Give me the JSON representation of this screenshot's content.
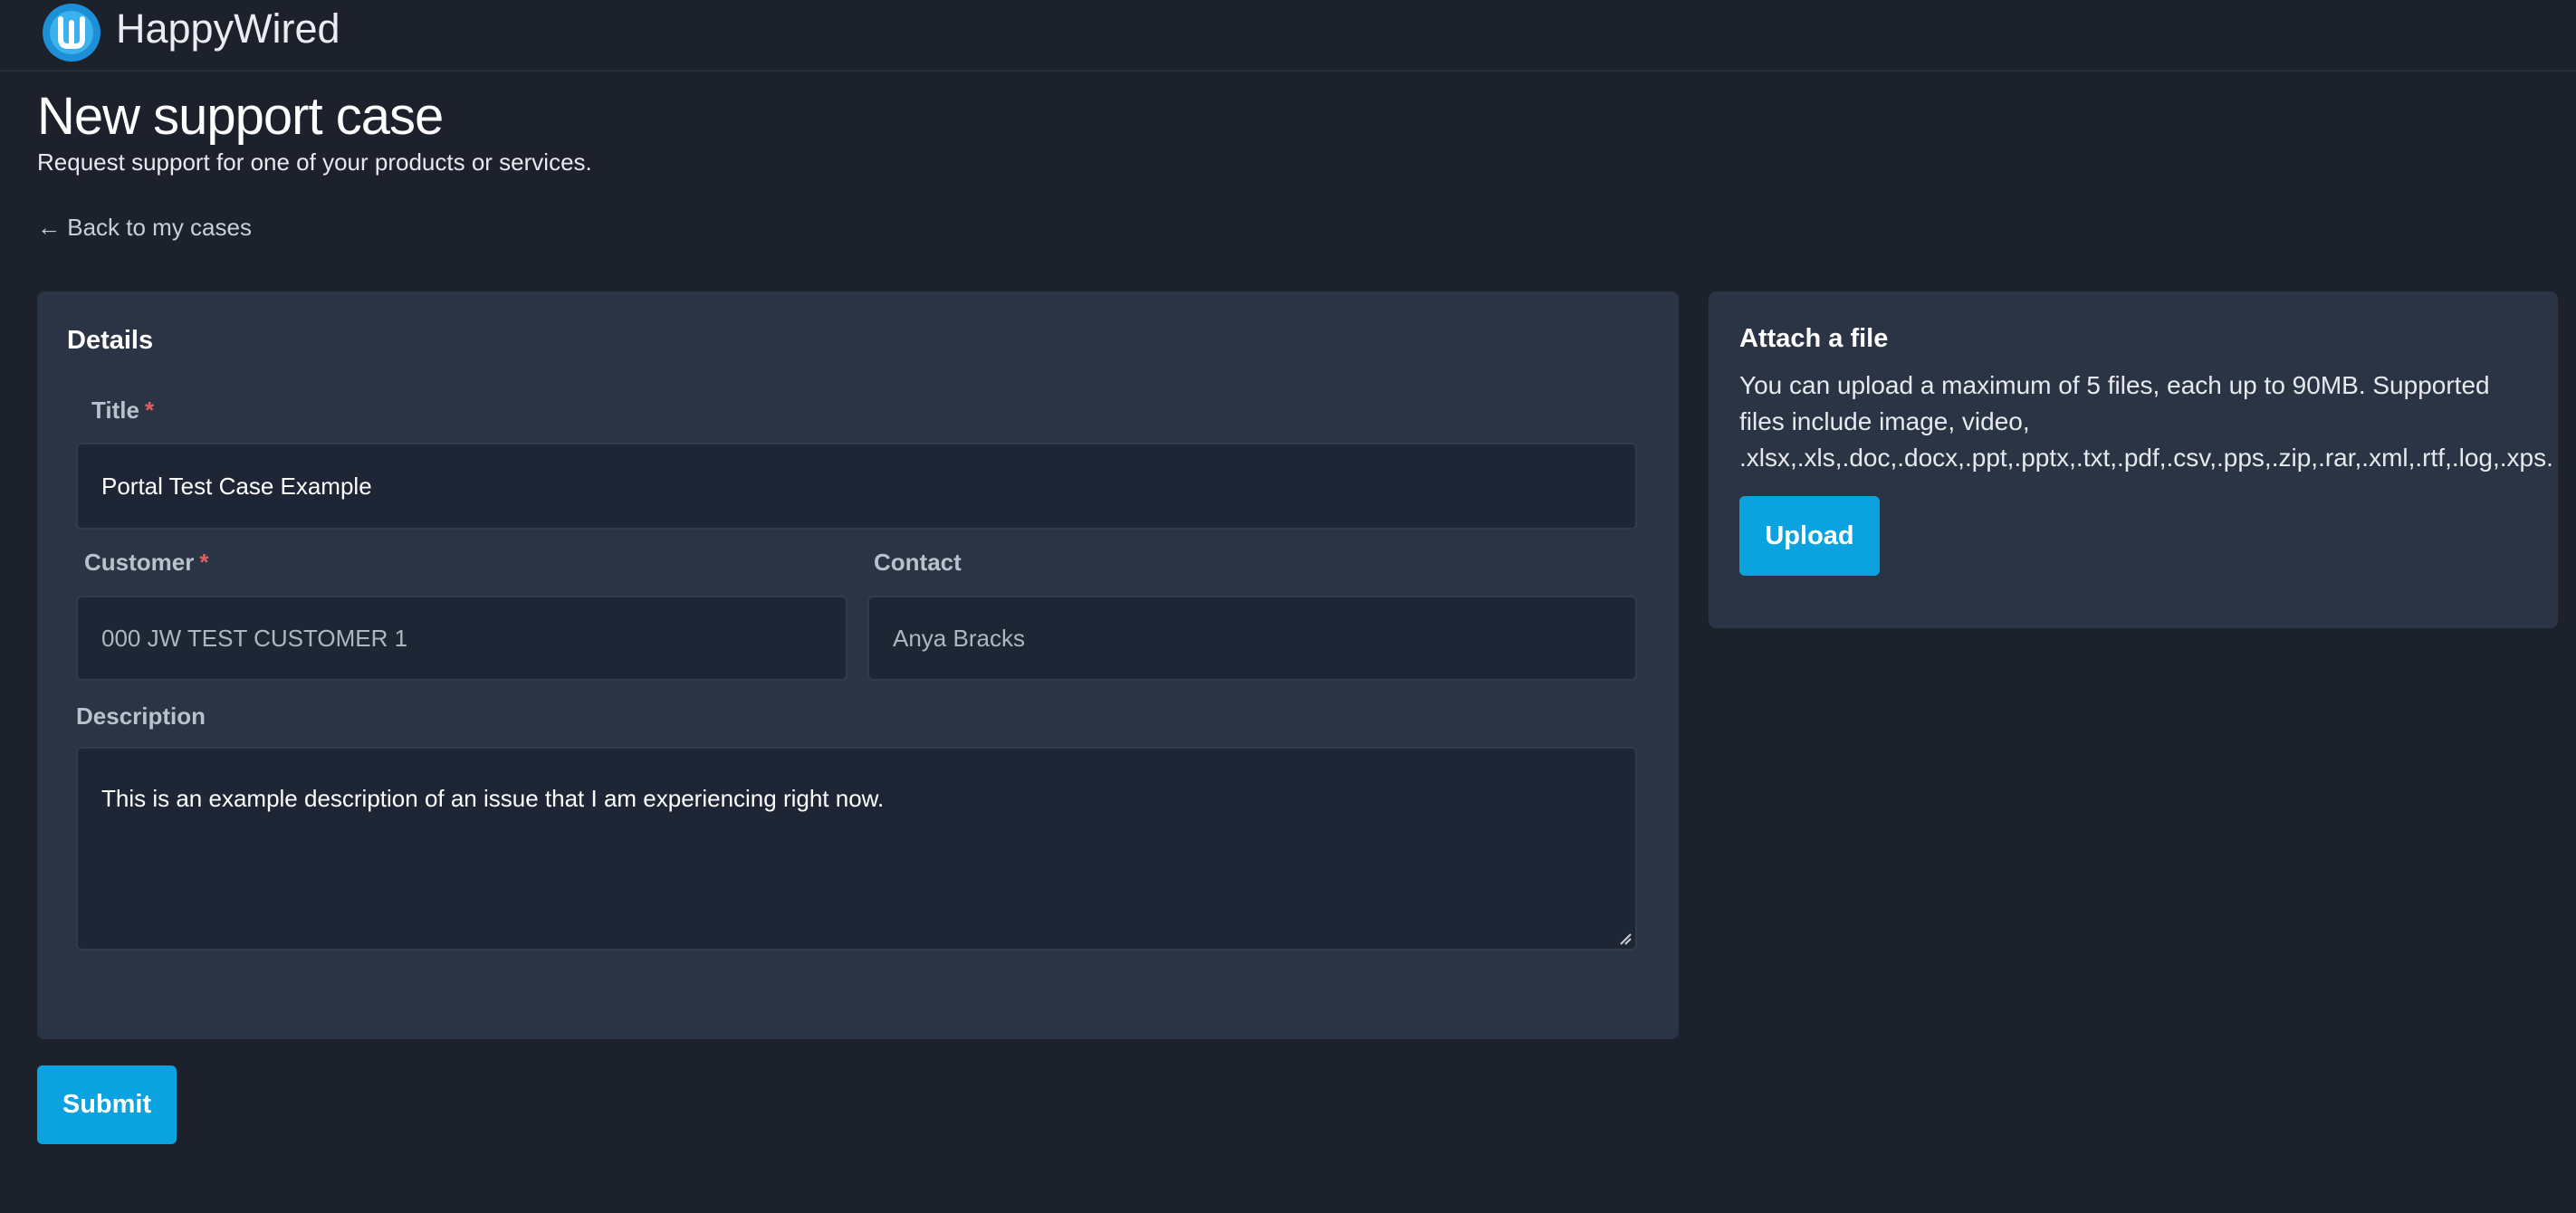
{
  "app": {
    "brand": "HappyWired",
    "accent": "#0aa3e0",
    "required_color": "#e06060"
  },
  "header": {
    "logo_icon": "happywired-logo-icon"
  },
  "page": {
    "title": "New support case",
    "subtitle": "Request support for one of your products or services.",
    "back_link": "← Back to my cases"
  },
  "details": {
    "heading": "Details",
    "title_label": "Title",
    "title_value": "Portal Test Case Example",
    "customer_label": "Customer",
    "customer_value": "000 JW TEST CUSTOMER 1",
    "contact_label": "Contact",
    "contact_value": "Anya Bracks",
    "description_label": "Description",
    "description_value": "This is an example description of an issue that I am experiencing right now.",
    "required_marker": "*"
  },
  "attach": {
    "heading": "Attach a file",
    "line1": "You can upload a maximum of 5 files, each up to 90MB. Supported",
    "line2": "files include image, video,",
    "line3": ".xlsx,.xls,.doc,.docx,.ppt,.pptx,.txt,.pdf,.csv,.pps,.zip,.rar,.xml,.rtf,.log,.xps.",
    "upload_label": "Upload"
  },
  "actions": {
    "submit_label": "Submit"
  }
}
